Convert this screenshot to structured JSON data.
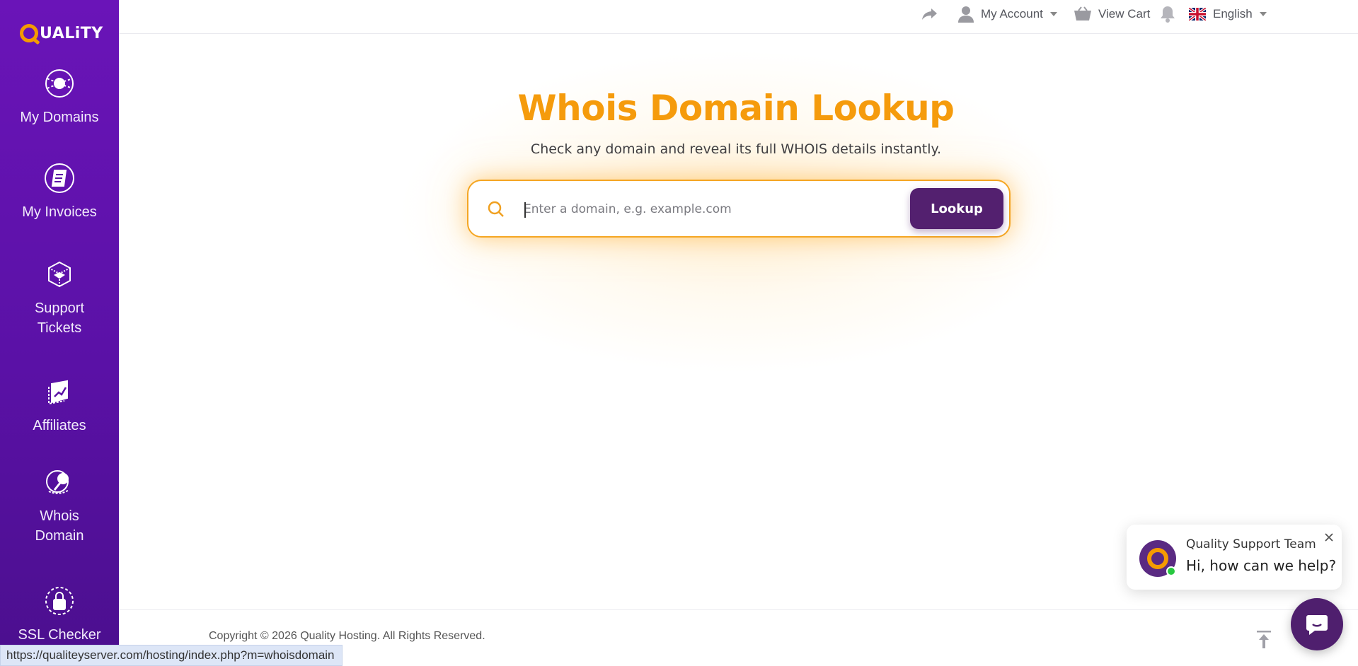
{
  "brand": {
    "logo_text": "UALiTY",
    "logo_full": "QUALiTY"
  },
  "sidebar": {
    "items": [
      {
        "label": "My Domains",
        "icon": "globe-icon"
      },
      {
        "label": "My Invoices",
        "icon": "invoice-icon"
      },
      {
        "label": "Support Tickets",
        "icon": "support-box-icon"
      },
      {
        "label": "Affiliates",
        "icon": "affiliates-chart-icon"
      },
      {
        "label": "Whois Domain",
        "icon": "whois-search-icon"
      },
      {
        "label": "SSL Checker",
        "icon": "ssl-lock-icon"
      }
    ]
  },
  "topbar": {
    "account_label": "My Account",
    "cart_label": "View Cart",
    "language_label": "English"
  },
  "main": {
    "title": "Whois Domain Lookup",
    "subtitle": "Check any domain and reveal its full WHOIS details instantly.",
    "search_placeholder": "Enter a domain, e.g. example.com",
    "lookup_label": "Lookup"
  },
  "footer": {
    "copyright": "Copyright © 2026 Quality Hosting. All Rights Reserved."
  },
  "statusbar": {
    "url": "https://qualiteyserver.com/hosting/index.php?m=whoisdomain"
  },
  "chat": {
    "team": "Quality Support Team",
    "message": "Hi, how can we help?"
  },
  "colors": {
    "accent": "#f59b0c",
    "sidebar": "#5a11a6",
    "button": "#53206f"
  }
}
